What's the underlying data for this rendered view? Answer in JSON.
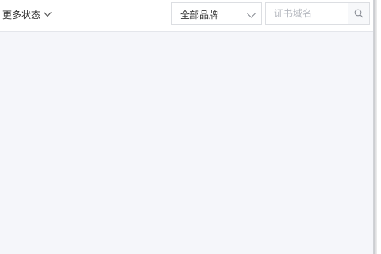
{
  "filters": {
    "more_status_label": "更多状态",
    "more_status_icon": "chevron-down-icon",
    "brand_select": {
      "selected": "全部品牌",
      "icon": "chevron-down-icon"
    }
  },
  "search": {
    "value": "",
    "placeholder": "证书域名",
    "icon": "search-icon"
  },
  "colors": {
    "content_background": "#f5f6fa",
    "border": "#dcdee2",
    "text": "#333333",
    "placeholder": "#b5b8bf"
  }
}
